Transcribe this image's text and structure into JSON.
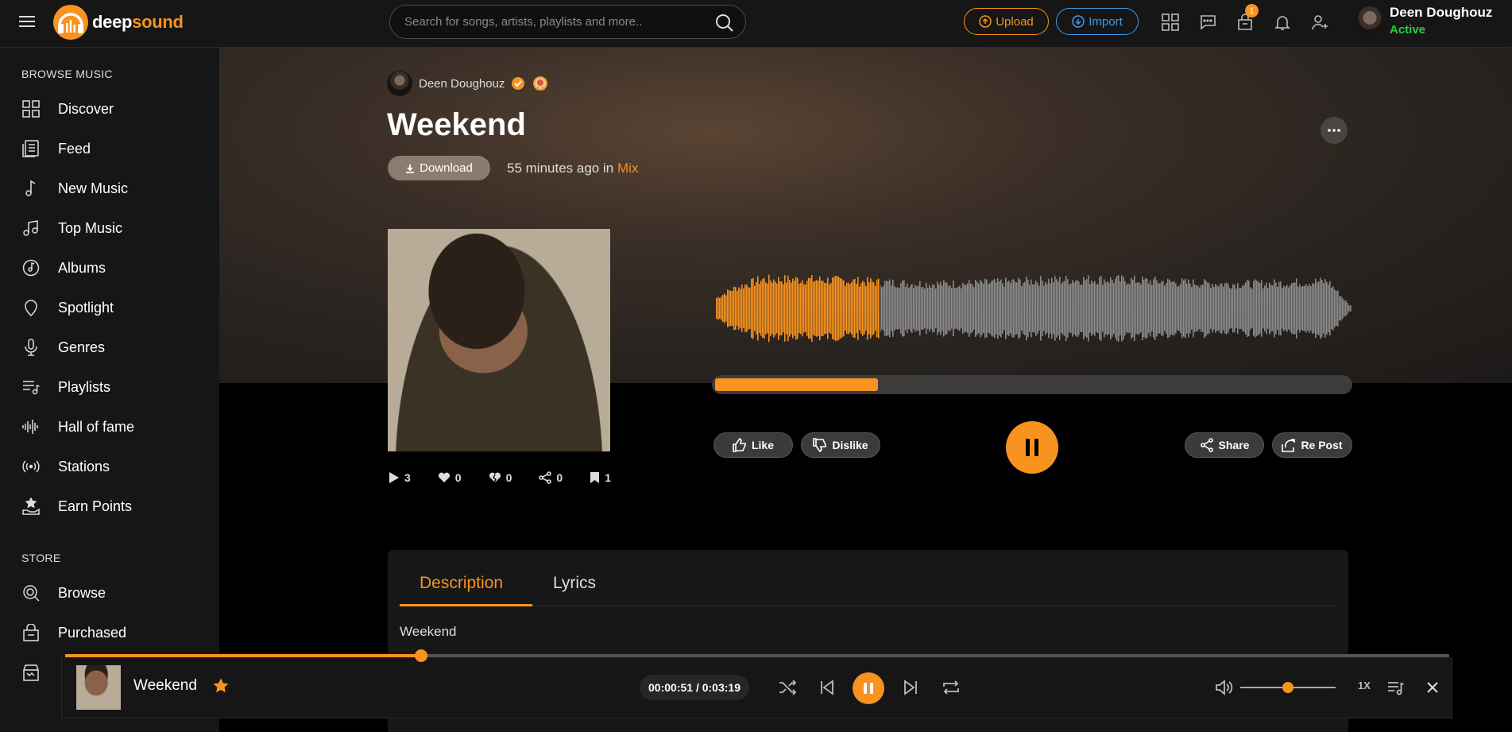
{
  "brand": {
    "part1": "deep",
    "part2": "sound",
    "accent": "#f7931e"
  },
  "header": {
    "search_placeholder": "Search for songs, artists, playlists and more..",
    "upload_label": "Upload",
    "import_label": "Import",
    "notification_count": "1",
    "user_name": "Deen Doughouz",
    "user_status": "Active",
    "icons": [
      "grid-icon",
      "messages-icon",
      "store-icon",
      "bell-icon",
      "add-user-icon"
    ]
  },
  "sidebar": {
    "browse_title": "BROWSE MUSIC",
    "items": [
      {
        "label": "Discover",
        "icon": "grid-icon"
      },
      {
        "label": "Feed",
        "icon": "feed-icon"
      },
      {
        "label": "New Music",
        "icon": "music-note-icon"
      },
      {
        "label": "Top Music",
        "icon": "music-notes-icon"
      },
      {
        "label": "Albums",
        "icon": "album-icon"
      },
      {
        "label": "Spotlight",
        "icon": "spotlight-icon"
      },
      {
        "label": "Genres",
        "icon": "microphone-icon"
      },
      {
        "label": "Playlists",
        "icon": "playlist-icon"
      },
      {
        "label": "Hall of fame",
        "icon": "waveform-icon"
      },
      {
        "label": "Stations",
        "icon": "radio-icon"
      },
      {
        "label": "Earn Points",
        "icon": "earn-points-icon"
      }
    ],
    "store_title": "STORE",
    "store_items": [
      {
        "label": "Browse",
        "icon": "browse-icon"
      },
      {
        "label": "Purchased",
        "icon": "purchased-icon"
      }
    ]
  },
  "track": {
    "artist": "Deen Doughouz",
    "title": "Weekend",
    "download_label": "Download",
    "time_ago": "55 minutes ago in",
    "category": "Mix",
    "progress": 0.257,
    "like_label": "Like",
    "dislike_label": "Dislike",
    "share_label": "Share",
    "repost_label": "Re Post",
    "stats": {
      "plays": "3",
      "likes": "0",
      "dislikes": "0",
      "shares": "0",
      "saves": "1"
    }
  },
  "description": {
    "tabs": [
      "Description",
      "Lyrics"
    ],
    "active_tab": "Description",
    "text": "Weekend"
  },
  "player": {
    "title": "Weekend",
    "time_current": "00:00:51",
    "time_total": "0:03:19",
    "time_display": "00:00:51 / 0:03:19",
    "progress": 0.257,
    "volume": 0.5,
    "speed": "1X"
  }
}
